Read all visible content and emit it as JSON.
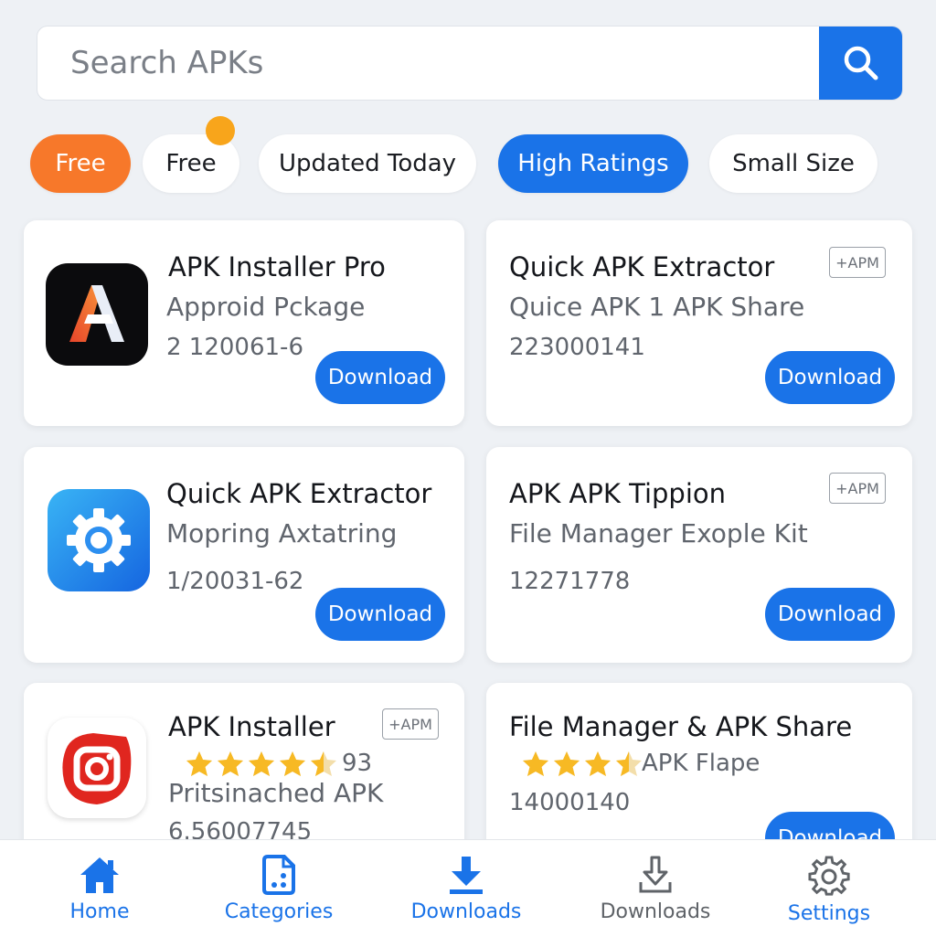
{
  "search": {
    "placeholder": "Search APKs"
  },
  "chips": [
    {
      "label": "Free"
    },
    {
      "label": "Free"
    },
    {
      "label": "Updated Today"
    },
    {
      "label": "High Ratings"
    },
    {
      "label": "Small Size"
    }
  ],
  "cards": [
    {
      "title": "APK Installer Pro",
      "subtitle": "Approid Pckage",
      "code": "2 120061-6",
      "button": "Download"
    },
    {
      "title": "Quick APK Extractor",
      "subtitle": "Quice APK 1 APK Share",
      "code": "223000141",
      "button": "Download",
      "badge": "+APM"
    },
    {
      "title": "Quick APK Extractor",
      "subtitle": "Mopring  Axtatring",
      "code": "1/20031-62",
      "button": "Download"
    },
    {
      "title": "APK APK Tippion",
      "subtitle": "File Manager Exople Kit",
      "code": "12271778",
      "button": "Download",
      "badge": "+APM"
    },
    {
      "title": "APK Installer",
      "rating_text": "93",
      "stars": 4.5,
      "subtitle": "Pritsinached APK",
      "code": "6.56007745",
      "badge": "+APM"
    },
    {
      "title": "File Manager & APK Share",
      "stars": 3.5,
      "rating_text": "APK Flape",
      "code": "14000140",
      "button": "Download"
    }
  ],
  "nav": [
    {
      "label": "Home",
      "icon": "home-icon"
    },
    {
      "label": "Categories",
      "icon": "categories-icon"
    },
    {
      "label": "Downloads",
      "icon": "download-icon"
    },
    {
      "label": "Downloads",
      "icon": "download-outline-icon"
    },
    {
      "label": "Settings",
      "icon": "settings-icon"
    }
  ],
  "colors": {
    "accent": "#1a73e8",
    "orange": "#f7782a",
    "dot": "#f8a51b",
    "star": "#f7b924"
  }
}
